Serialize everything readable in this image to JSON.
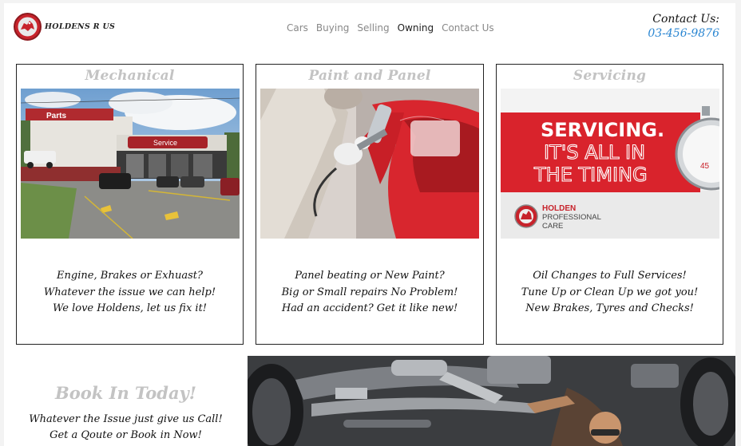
{
  "header": {
    "brand": "HOLDENS R US",
    "nav": [
      "Cars",
      "Buying",
      "Selling",
      "Owning",
      "Contact Us"
    ],
    "active_nav": "Owning",
    "contact_label": "Contact Us:",
    "contact_phone": "03-456-9876"
  },
  "services": [
    {
      "title": "Mechanical",
      "image_signs": [
        "Parts",
        "Service"
      ],
      "lines": [
        "Engine, Brakes or Exhuast?",
        "Whatever the issue we can help!",
        "We love Holdens, let us fix it!"
      ]
    },
    {
      "title": "Paint and Panel",
      "lines": [
        "Panel beating or New Paint?",
        "Big or Small repairs No Problem!",
        "Had an accident? Get it like new!"
      ]
    },
    {
      "title": "Servicing",
      "image_headline": [
        "SERVICING.",
        "IT'S ALL IN",
        "THE TIMING"
      ],
      "image_brand": [
        "HOLDEN",
        "PROFESSIONAL",
        "CARE"
      ],
      "image_timer": "45",
      "lines": [
        "Oil Changes to Full Services!",
        "Tune Up or Clean Up we got you!",
        "New Brakes, Tyres and Checks!"
      ]
    }
  ],
  "booking": {
    "title": "Book In Today!",
    "lines": [
      "Whatever the Issue just give us Call!",
      "Get a Qoute or Book in Now!"
    ]
  },
  "colors": {
    "brand_red": "#c7232b",
    "phone_blue": "#2a86d2",
    "heading_grey": "#c3c3c3"
  }
}
